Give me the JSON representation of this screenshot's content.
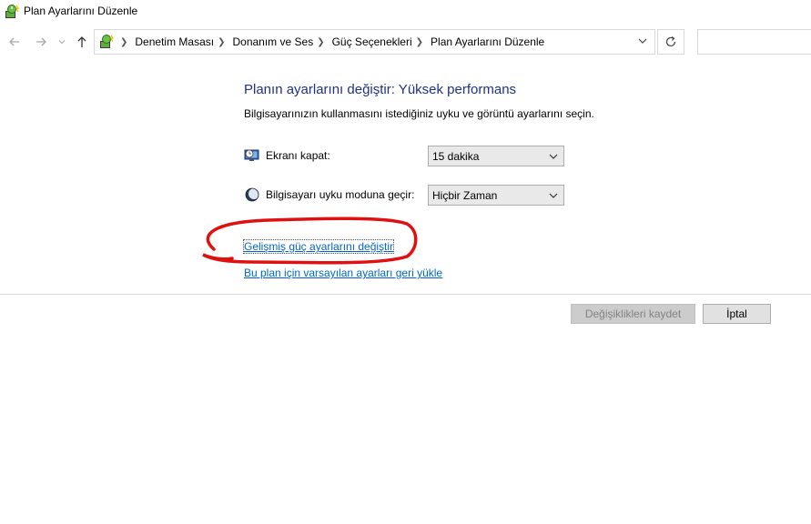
{
  "window": {
    "title": "Plan Ayarlarını Düzenle",
    "icon": "power-plan-icon"
  },
  "navigation": {
    "back_icon": "back-arrow-icon",
    "forward_icon": "forward-arrow-icon",
    "up_icon": "up-arrow-icon",
    "breadcrumbs": [
      "Denetim Masası",
      "Donanım ve Ses",
      "Güç Seçenekleri",
      "Plan Ayarlarını Düzenle"
    ],
    "refresh_icon": "refresh-icon",
    "search_placeholder": ""
  },
  "main": {
    "heading": "Planın ayarlarını değiştir: Yüksek performans",
    "subtitle": "Bilgisayarınızın kullanmasını istediğiniz uyku ve görüntü ayarlarını seçin.",
    "settings": [
      {
        "icon": "monitor-clock-icon",
        "label": "Ekranı kapat:",
        "value": "15 dakika"
      },
      {
        "icon": "moon-icon",
        "label": "Bilgisayarı uyku moduna geçir:",
        "value": "Hiçbir Zaman"
      }
    ],
    "links": {
      "advanced": "Gelişmiş güç ayarlarını değiştir",
      "restore": "Bu plan için varsayılan ayarları geri yükle"
    },
    "buttons": {
      "save": "Değişiklikleri kaydet",
      "cancel": "İptal"
    }
  },
  "colors": {
    "heading": "#1e3287",
    "link": "#0066cc",
    "annotation": "#e01010"
  }
}
